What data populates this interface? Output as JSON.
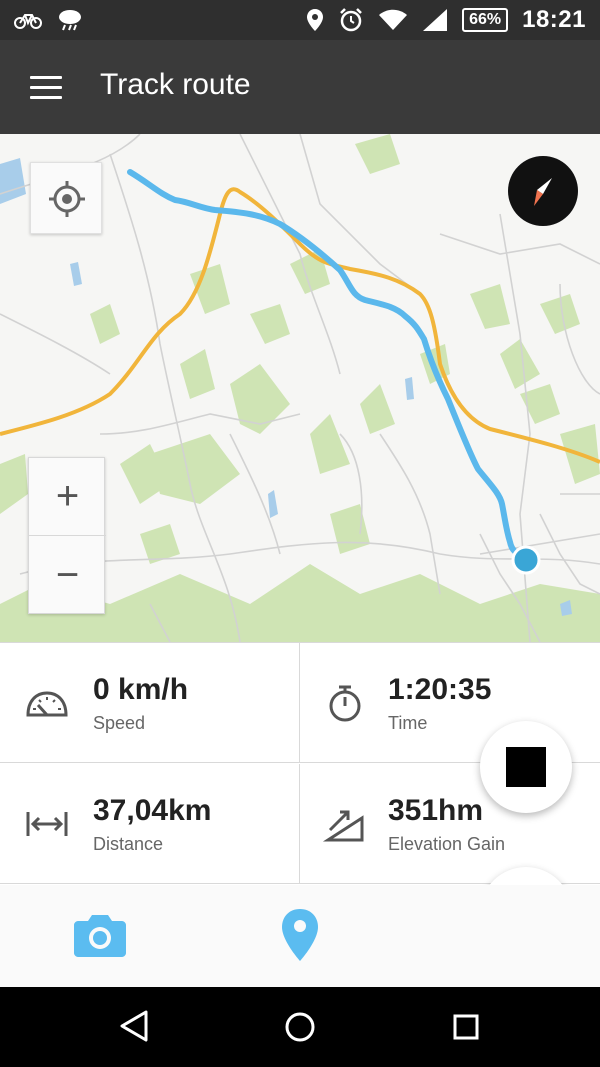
{
  "status_bar": {
    "left_icons": [
      "bike-icon",
      "weather-icon"
    ],
    "right_icons": [
      "location-icon",
      "alarm-icon",
      "wifi-icon",
      "signal-icon"
    ],
    "battery": "66%",
    "time": "18:21"
  },
  "app_bar": {
    "title": "Track route",
    "menu_icon": "menu-icon"
  },
  "map": {
    "controls": {
      "locate_icon": "crosshair-icon",
      "compass_icon": "compass-icon",
      "zoom_in": "+",
      "zoom_out": "−"
    },
    "colors": {
      "track": "#5bb8ec",
      "major_road": "#f1b53b",
      "position": "#3aa6d6",
      "vegetation": "#cfe4b4",
      "water": "#a8cdea"
    }
  },
  "stats": {
    "speed": {
      "value": "0 km/h",
      "label": "Speed",
      "icon": "speedometer-icon"
    },
    "time": {
      "value": "1:20:35",
      "label": "Time",
      "icon": "stopwatch-icon"
    },
    "distance": {
      "value": "37,04km",
      "label": "Distance",
      "icon": "distance-icon"
    },
    "elevation": {
      "value": "351hm",
      "label": "Elevation Gain",
      "icon": "elevation-icon"
    }
  },
  "actions": {
    "stop_icon": "stop-icon",
    "record_icon": "record-icon",
    "camera_icon": "camera-icon",
    "pin_icon": "map-pin-icon",
    "accent": "#5bbcf0",
    "record_color": "#d9001b"
  },
  "nav_bar": {
    "icons": [
      "back-icon",
      "home-icon",
      "recents-icon"
    ]
  }
}
